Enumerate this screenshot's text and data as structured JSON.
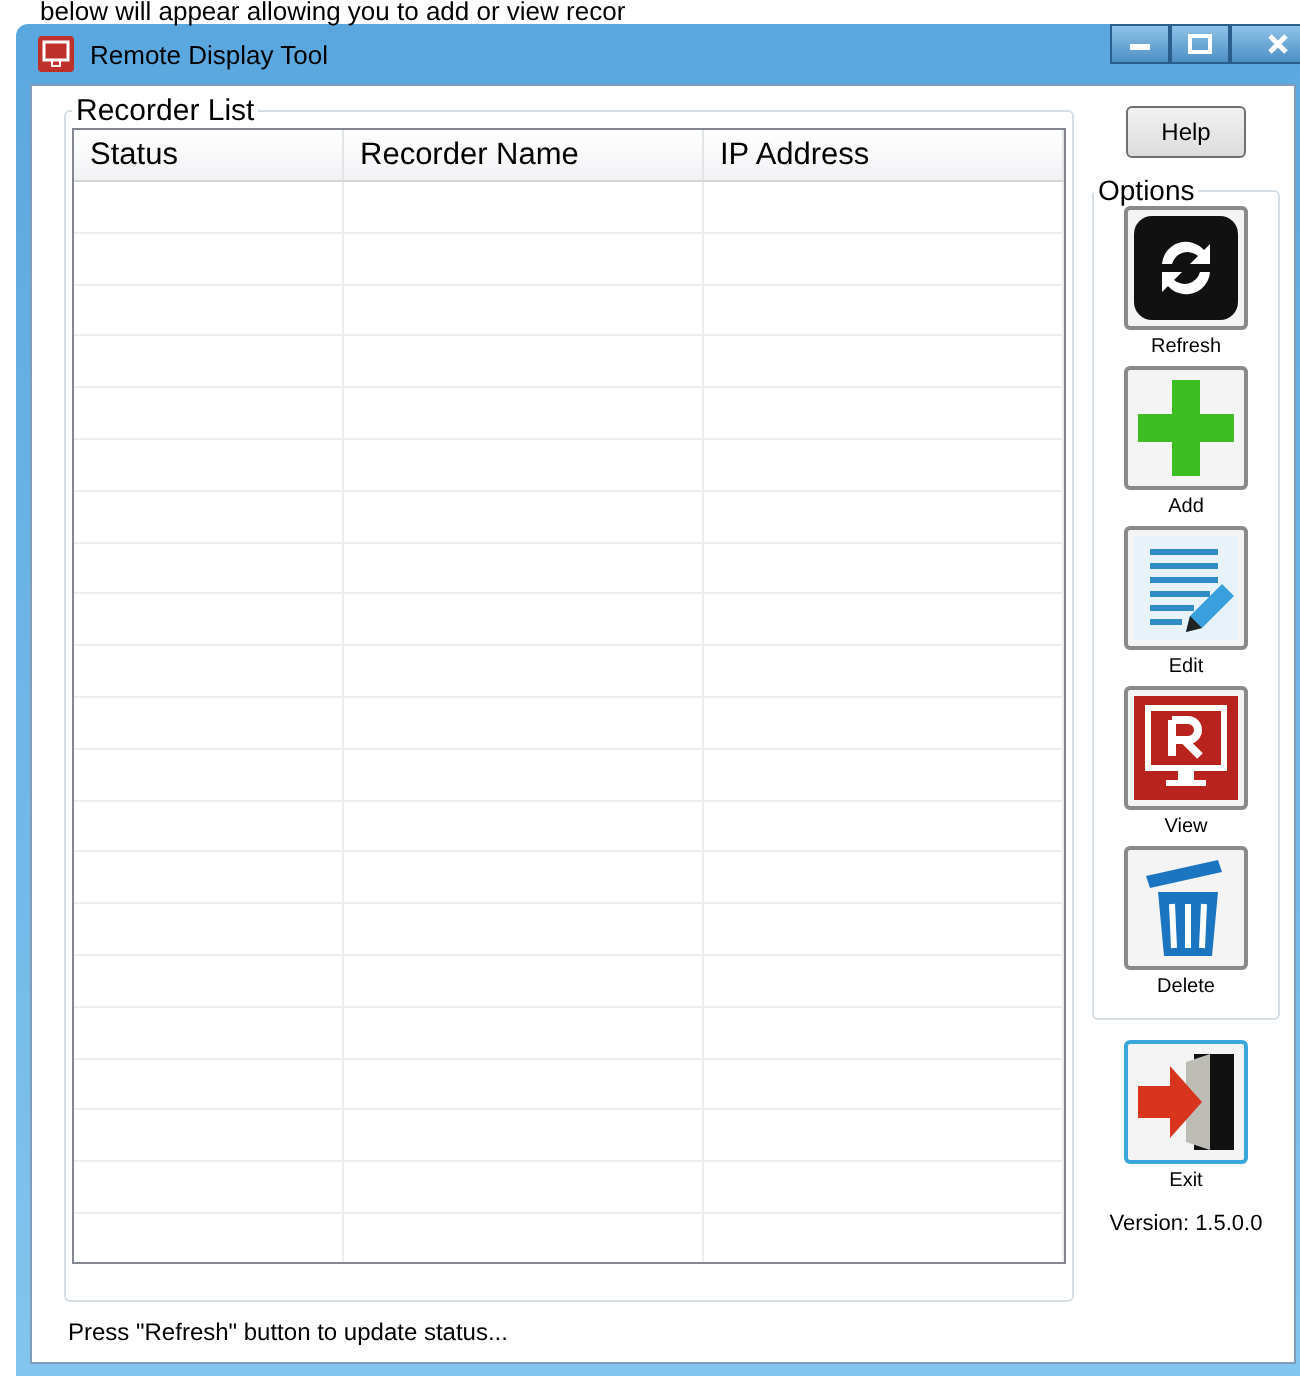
{
  "page_text_above": "below will appear allowing you to add or view recor",
  "window": {
    "title": "Remote Display Tool"
  },
  "recorder_list": {
    "title": "Recorder List",
    "columns": [
      "Status",
      "Recorder Name",
      "IP Address"
    ]
  },
  "help_button": "Help",
  "options": {
    "title": "Options",
    "buttons": [
      {
        "kind": "refresh",
        "label": "Refresh",
        "selected": false
      },
      {
        "kind": "add",
        "label": "Add",
        "selected": false
      },
      {
        "kind": "edit",
        "label": "Edit",
        "selected": false
      },
      {
        "kind": "view",
        "label": "View",
        "selected": false
      },
      {
        "kind": "delete",
        "label": "Delete",
        "selected": false
      }
    ]
  },
  "exit_button": {
    "kind": "exit",
    "label": "Exit",
    "selected": true
  },
  "status_bar": "Press \"Refresh\" button to update status...",
  "version": "Version: 1.5.0.0"
}
